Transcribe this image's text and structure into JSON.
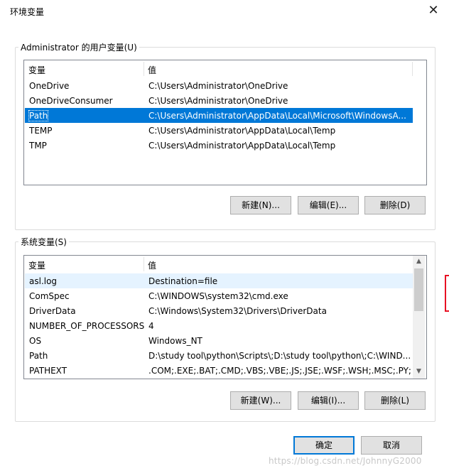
{
  "window": {
    "title": "环境变量",
    "close_glyph": "✕"
  },
  "user_group": {
    "legend": "Administrator 的用户变量(U)",
    "header": {
      "col1": "变量",
      "col2": "值"
    },
    "rows": [
      {
        "name": "OneDrive",
        "value": "C:\\Users\\Administrator\\OneDrive"
      },
      {
        "name": "OneDriveConsumer",
        "value": "C:\\Users\\Administrator\\OneDrive"
      },
      {
        "name": "Path",
        "value": "C:\\Users\\Administrator\\AppData\\Local\\Microsoft\\WindowsA..."
      },
      {
        "name": "TEMP",
        "value": "C:\\Users\\Administrator\\AppData\\Local\\Temp"
      },
      {
        "name": "TMP",
        "value": "C:\\Users\\Administrator\\AppData\\Local\\Temp"
      }
    ],
    "buttons": {
      "new": "新建(N)...",
      "edit": "编辑(E)...",
      "delete": "删除(D)"
    }
  },
  "system_group": {
    "legend": "系统变量(S)",
    "header": {
      "col1": "变量",
      "col2": "值"
    },
    "rows": [
      {
        "name": "asl.log",
        "value": "Destination=file"
      },
      {
        "name": "ComSpec",
        "value": "C:\\WINDOWS\\system32\\cmd.exe"
      },
      {
        "name": "DriverData",
        "value": "C:\\Windows\\System32\\Drivers\\DriverData"
      },
      {
        "name": "NUMBER_OF_PROCESSORS",
        "value": "4"
      },
      {
        "name": "OS",
        "value": "Windows_NT"
      },
      {
        "name": "Path",
        "value": "D:\\study tool\\python\\Scripts\\;D:\\study tool\\python\\;C:\\WIND..."
      },
      {
        "name": "PATHEXT",
        "value": ".COM;.EXE;.BAT;.CMD;.VBS;.VBE;.JS;.JSE;.WSF;.WSH;.MSC;.PY;.P..."
      }
    ],
    "buttons": {
      "new": "新建(W)...",
      "edit": "编辑(I)...",
      "delete": "删除(L)"
    }
  },
  "dialog_buttons": {
    "ok": "确定",
    "cancel": "取消"
  },
  "watermark": "https://blog.csdn.net/JohnnyG2000",
  "colors": {
    "selection": "#0078d7",
    "hover": "#e5f3ff",
    "button_face": "#e1e1e1",
    "accent_border": "#0078d7"
  }
}
